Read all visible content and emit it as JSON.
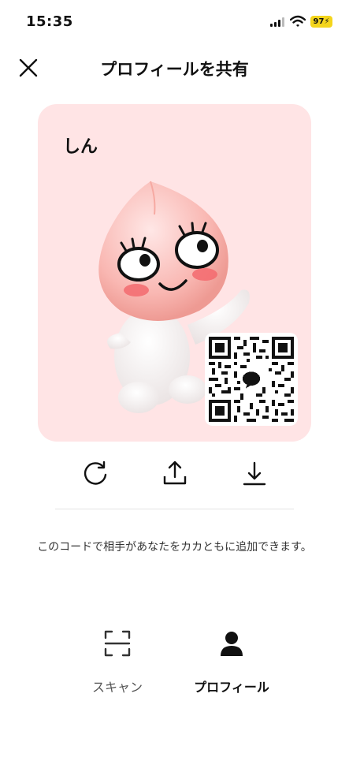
{
  "status_bar": {
    "time": "15:35",
    "battery_level": "97"
  },
  "header": {
    "title": "プロフィールを共有",
    "close_icon": "close-icon"
  },
  "card": {
    "name": "しん",
    "background_color": "#ffe4e5",
    "character_icon": "peach-character-icon",
    "qr_icon": "qr-code-icon"
  },
  "actions": [
    {
      "icon": "refresh-icon"
    },
    {
      "icon": "share-upload-icon"
    },
    {
      "icon": "download-icon"
    }
  ],
  "description": "このコードで相手があなたをカカともに追加できます。",
  "tabs": [
    {
      "label": "スキャン",
      "icon": "scan-icon",
      "selected": false
    },
    {
      "label": "プロフィール",
      "icon": "person-icon",
      "selected": true
    }
  ]
}
